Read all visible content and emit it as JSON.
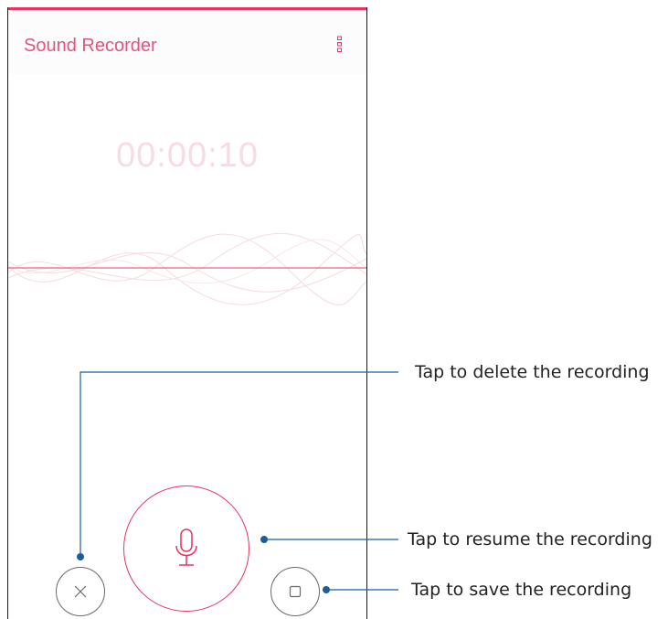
{
  "app": {
    "title": "Sound Recorder",
    "timer": "00:00:10",
    "menu_icon": "more-vertical-icon"
  },
  "controls": {
    "delete_icon": "close-icon",
    "record_icon": "microphone-icon",
    "save_icon": "stop-square-icon"
  },
  "callouts": {
    "delete": "Tap to delete the recording",
    "resume": "Tap to resume the recording",
    "save": "Tap to save the recording"
  },
  "colors": {
    "accent": "#e8325f",
    "title": "#e4537a",
    "timer": "#f9dbe3",
    "callout_line": "#1b5e9b"
  }
}
